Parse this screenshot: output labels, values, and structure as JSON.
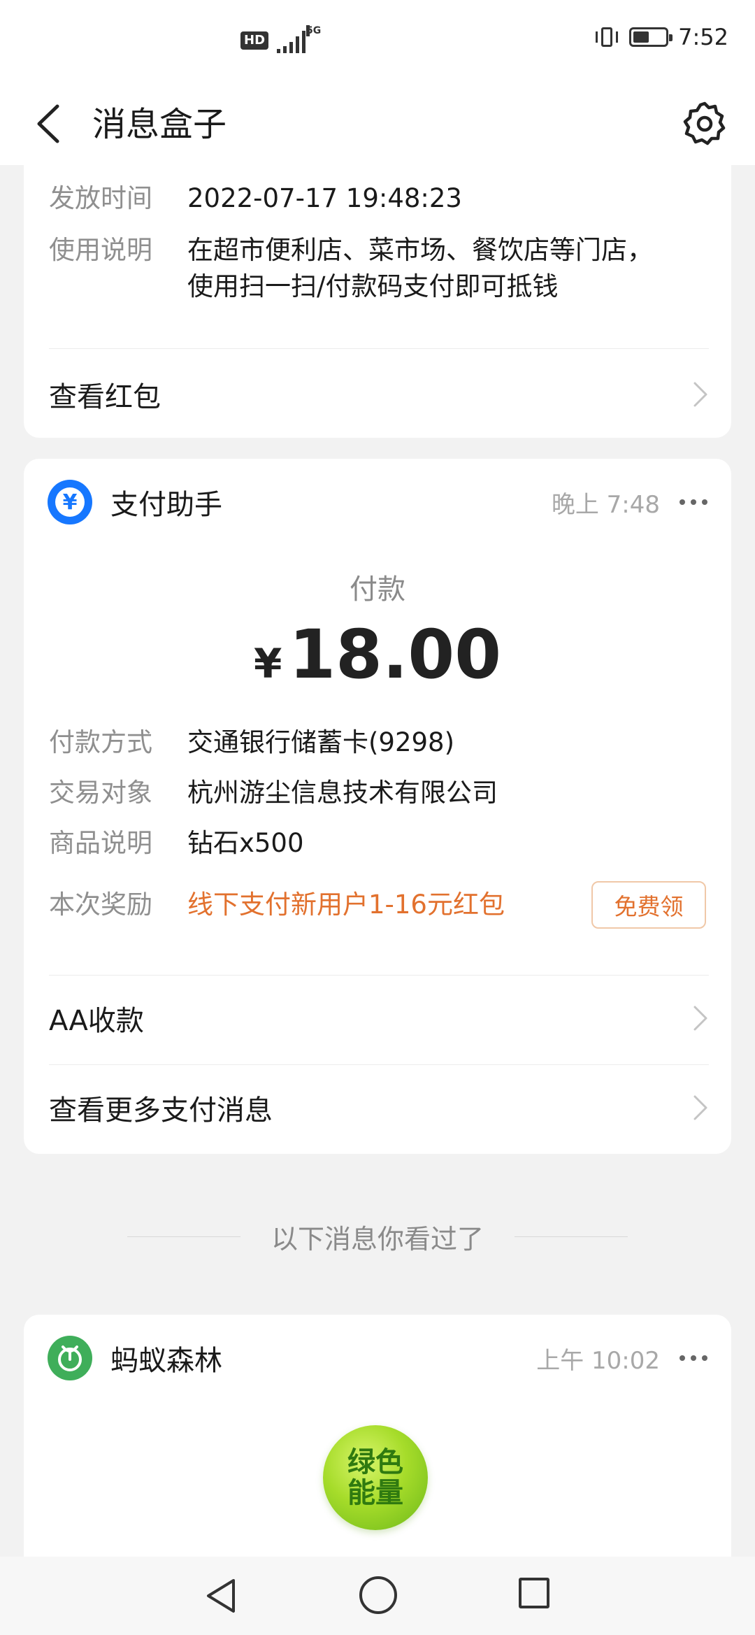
{
  "status_bar": {
    "hd": "HD",
    "network": "5G",
    "time": "7:52"
  },
  "header": {
    "title": "消息盒子"
  },
  "card_redpacket": {
    "issue_time_label": "发放时间",
    "issue_time_value": "2022-07-17 19:48:23",
    "usage_label": "使用说明",
    "usage_line1": "在超市便利店、菜市场、餐饮店等门店，",
    "usage_line2": "使用扫一扫/付款码支付即可抵钱",
    "view_link": "查看红包"
  },
  "card_payment": {
    "app_name": "支付助手",
    "app_icon_glyph": "¥",
    "time": "晚上 7:48",
    "pay_label": "付款",
    "currency": "¥",
    "amount": "18.00",
    "method_label": "付款方式",
    "method_value": "交通银行储蓄卡(9298)",
    "counterparty_label": "交易对象",
    "counterparty_value": "杭州游尘信息技术有限公司",
    "goods_label": "商品说明",
    "goods_value": "钻石x500",
    "reward_label": "本次奖励",
    "reward_value": "线下支付新用户1-16元红包",
    "reward_button": "免费领",
    "aa_link": "AA收款",
    "more_link": "查看更多支付消息"
  },
  "seen_separator": "以下消息你看过了",
  "card_forest": {
    "app_name": "蚂蚁森林",
    "time": "上午 10:02",
    "energy_line1": "绿色",
    "energy_line2": "能量"
  },
  "colors": {
    "accent_orange": "#e2712e",
    "payment_blue": "#1677ff",
    "forest_green": "#3fae5a"
  }
}
